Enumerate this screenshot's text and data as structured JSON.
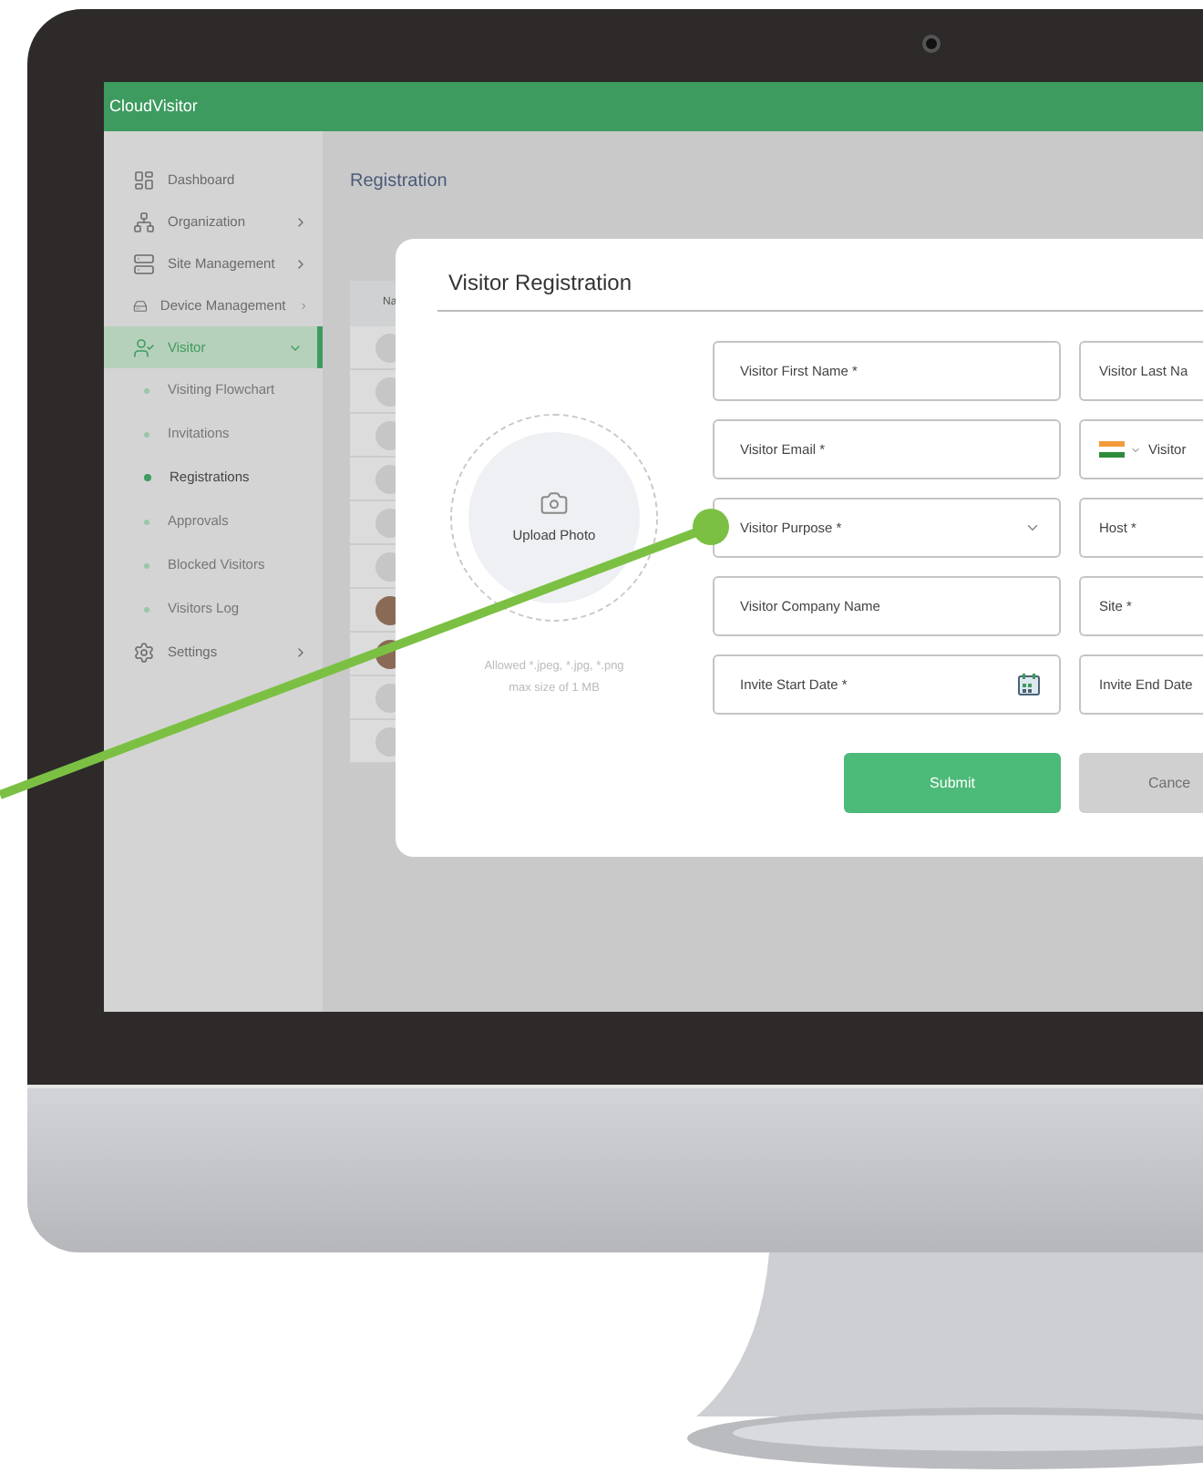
{
  "app": {
    "title": "CloudVisitor"
  },
  "sidebar": {
    "items": [
      {
        "label": "Dashboard",
        "expandable": false,
        "expanded": false,
        "selected": false
      },
      {
        "label": "Organization",
        "expandable": true,
        "expanded": false,
        "selected": false
      },
      {
        "label": "Site Management",
        "expandable": true,
        "expanded": false,
        "selected": false
      },
      {
        "label": "Device Management",
        "expandable": true,
        "expanded": false,
        "selected": false
      },
      {
        "label": "Visitor",
        "expandable": true,
        "expanded": true,
        "selected": true,
        "children": [
          {
            "label": "Visiting Flowchart",
            "selected": false
          },
          {
            "label": "Invitations",
            "selected": false
          },
          {
            "label": "Registrations",
            "selected": true
          },
          {
            "label": "Approvals",
            "selected": false
          },
          {
            "label": "Blocked Visitors",
            "selected": false
          },
          {
            "label": "Visitors Log",
            "selected": false
          }
        ]
      },
      {
        "label": "Settings",
        "expandable": true,
        "expanded": false,
        "selected": false
      }
    ]
  },
  "page": {
    "title": "Registration"
  },
  "table": {
    "columns": [
      "Na"
    ],
    "rows": [
      {
        "kind": "initials"
      },
      {
        "kind": "initials"
      },
      {
        "kind": "initials"
      },
      {
        "kind": "initials"
      },
      {
        "kind": "initials"
      },
      {
        "kind": "initials"
      },
      {
        "kind": "photo"
      },
      {
        "kind": "photo"
      },
      {
        "kind": "initials"
      },
      {
        "kind": "initials"
      }
    ]
  },
  "modal": {
    "title": "Visitor Registration",
    "upload": {
      "label": "Upload Photo",
      "hint_lines": [
        "Allowed *.jpeg, *.jpg, *.png",
        "max size of 1 MB"
      ]
    },
    "fields": [
      {
        "placeholder": "Visitor First Name *",
        "kind": "text"
      },
      {
        "placeholder": "Visitor Last Na",
        "kind": "text"
      },
      {
        "placeholder": "Visitor Email *",
        "kind": "text"
      },
      {
        "placeholder": "Visitor",
        "kind": "phone"
      },
      {
        "placeholder": "Visitor Purpose *",
        "kind": "select"
      },
      {
        "placeholder": "Host *",
        "kind": "text"
      },
      {
        "placeholder": "Visitor Company Name",
        "kind": "text"
      },
      {
        "placeholder": "Site *",
        "kind": "text"
      },
      {
        "placeholder": "Invite Start Date *",
        "kind": "date"
      },
      {
        "placeholder": "Invite End Date",
        "kind": "text"
      }
    ],
    "buttons": [
      {
        "label": "Submit",
        "kind": "primary"
      },
      {
        "label": "Cance",
        "kind": "secondary"
      }
    ]
  }
}
